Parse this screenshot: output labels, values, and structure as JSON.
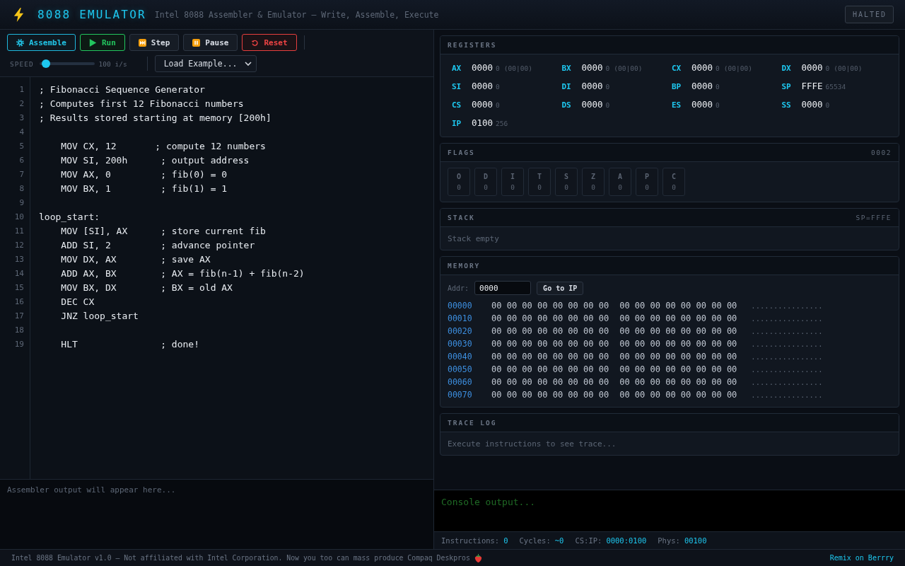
{
  "header": {
    "title": "8088 EMULATOR",
    "subtitle": "Intel 8088 Assembler & Emulator — Write, Assemble, Execute",
    "status": "HALTED"
  },
  "toolbar": {
    "buttons": [
      {
        "label": "Assemble",
        "kind": "assemble"
      },
      {
        "label": "Run",
        "kind": "run"
      },
      {
        "label": "Step",
        "kind": "step"
      },
      {
        "label": "Pause",
        "kind": "pause"
      },
      {
        "label": "Reset",
        "kind": "reset"
      }
    ],
    "speed": {
      "label": "SPEED",
      "level": 0.12,
      "reading": "100 i/s"
    },
    "example_select": {
      "value": "Load Example..."
    }
  },
  "editor": {
    "lines": [
      {
        "number": "1",
        "text": "; Fibonacci Sequence Generator"
      },
      {
        "number": "2",
        "text": "; Computes first 12 Fibonacci numbers"
      },
      {
        "number": "3",
        "text": "; Results stored starting at memory [200h]"
      },
      {
        "number": "4"
      },
      {
        "number": "5",
        "text": "    MOV CX, 12       ; compute 12 numbers"
      },
      {
        "number": "6",
        "text": "    MOV SI, 200h      ; output address"
      },
      {
        "number": "7",
        "text": "    MOV AX, 0         ; fib(0) = 0"
      },
      {
        "number": "8",
        "text": "    MOV BX, 1         ; fib(1) = 1"
      },
      {
        "number": "9"
      },
      {
        "number": "10",
        "text": "loop_start:"
      },
      {
        "number": "11",
        "text": "    MOV [SI], AX      ; store current fib"
      },
      {
        "number": "12",
        "text": "    ADD SI, 2         ; advance pointer"
      },
      {
        "number": "13",
        "text": "    MOV DX, AX        ; save AX"
      },
      {
        "number": "14",
        "text": "    ADD AX, BX        ; AX = fib(n-1) + fib(n-2)"
      },
      {
        "number": "15",
        "text": "    MOV BX, DX        ; BX = old AX"
      },
      {
        "number": "16",
        "text": "    DEC CX"
      },
      {
        "number": "17",
        "text": "    JNZ loop_start"
      },
      {
        "number": "18"
      },
      {
        "number": "19",
        "text": "    HLT               ; done!"
      }
    ]
  },
  "assembler_output": {
    "message": "Assembler output will appear here..."
  },
  "registers": {
    "title": "REGISTERS",
    "items": [
      {
        "name": "AX",
        "hex": "0000",
        "decimal": "0",
        "bytes": "(00|00)"
      },
      {
        "name": "BX",
        "hex": "0000",
        "decimal": "0",
        "bytes": "(00|00)"
      },
      {
        "name": "CX",
        "hex": "0000",
        "decimal": "0",
        "bytes": "(00|00)"
      },
      {
        "name": "DX",
        "hex": "0000",
        "decimal": "0",
        "bytes": "(00|00)"
      },
      {
        "name": "SI",
        "hex": "0000",
        "decimal": "0"
      },
      {
        "name": "DI",
        "hex": "0000",
        "decimal": "0"
      },
      {
        "name": "BP",
        "hex": "0000",
        "decimal": "0"
      },
      {
        "name": "SP",
        "hex": "FFFE",
        "decimal": "65534"
      },
      {
        "name": "CS",
        "hex": "0000",
        "decimal": "0"
      },
      {
        "name": "DS",
        "hex": "0000",
        "decimal": "0"
      },
      {
        "name": "ES",
        "hex": "0000",
        "decimal": "0"
      },
      {
        "name": "SS",
        "hex": "0000",
        "decimal": "0"
      },
      {
        "name": "IP",
        "hex": "0100",
        "decimal": "256"
      }
    ]
  },
  "flags": {
    "title": "FLAGS",
    "value": "0002",
    "items": [
      {
        "name": "O",
        "value": "0",
        "set": false
      },
      {
        "name": "D",
        "value": "0",
        "set": false
      },
      {
        "name": "I",
        "value": "0",
        "set": false
      },
      {
        "name": "T",
        "value": "0",
        "set": false
      },
      {
        "name": "S",
        "value": "0",
        "set": false
      },
      {
        "name": "Z",
        "value": "0",
        "set": false
      },
      {
        "name": "A",
        "value": "0",
        "set": false
      },
      {
        "name": "P",
        "value": "0",
        "set": false
      },
      {
        "name": "C",
        "value": "0",
        "set": false
      }
    ]
  },
  "stack": {
    "title": "STACK",
    "pointer": "SP=FFFE",
    "message": "Stack empty"
  },
  "memory": {
    "title": "MEMORY",
    "address_label": "Addr:",
    "address_value": "0000",
    "goto_button": "Go to IP",
    "rows": [
      {
        "address": "00000",
        "bytes_low": "00 00 00 00 00 00 00 00",
        "bytes_high": "00 00 00 00 00 00 00 00",
        "ascii": "................"
      },
      {
        "address": "00010",
        "bytes_low": "00 00 00 00 00 00 00 00",
        "bytes_high": "00 00 00 00 00 00 00 00",
        "ascii": "................"
      },
      {
        "address": "00020",
        "bytes_low": "00 00 00 00 00 00 00 00",
        "bytes_high": "00 00 00 00 00 00 00 00",
        "ascii": "................"
      },
      {
        "address": "00030",
        "bytes_low": "00 00 00 00 00 00 00 00",
        "bytes_high": "00 00 00 00 00 00 00 00",
        "ascii": "................"
      },
      {
        "address": "00040",
        "bytes_low": "00 00 00 00 00 00 00 00",
        "bytes_high": "00 00 00 00 00 00 00 00",
        "ascii": "................"
      },
      {
        "address": "00050",
        "bytes_low": "00 00 00 00 00 00 00 00",
        "bytes_high": "00 00 00 00 00 00 00 00",
        "ascii": "................"
      },
      {
        "address": "00060",
        "bytes_low": "00 00 00 00 00 00 00 00",
        "bytes_high": "00 00 00 00 00 00 00 00",
        "ascii": "................"
      },
      {
        "address": "00070",
        "bytes_low": "00 00 00 00 00 00 00 00",
        "bytes_high": "00 00 00 00 00 00 00 00",
        "ascii": "................"
      }
    ]
  },
  "trace_log": {
    "title": "TRACE LOG",
    "message": "Execute instructions to see trace..."
  },
  "console": {
    "message": "Console output..."
  },
  "status_bar": [
    {
      "label": "Instructions:",
      "value": "0"
    },
    {
      "label": "Cycles:",
      "value": "~0"
    },
    {
      "label": "CS:IP:",
      "value": "0000:0100"
    },
    {
      "label": "Phys:",
      "value": "00100"
    }
  ],
  "footer": {
    "text": "Intel 8088 Emulator v1.0 — Not affiliated with Intel Corporation. Now you too can mass produce Compaq Deskpros",
    "link": "Remix on Berrry"
  }
}
